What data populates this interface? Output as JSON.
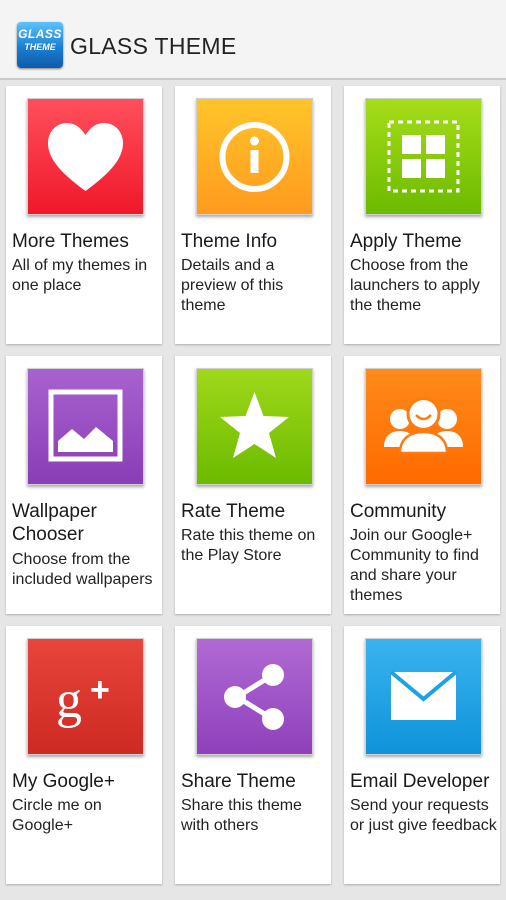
{
  "app": {
    "logo_text_1": "GLASS",
    "logo_text_2": "THEME",
    "title": "GLASS THEME"
  },
  "cards": [
    {
      "title": "More Themes",
      "desc": "All of my themes in one place",
      "icon": "heart-icon",
      "color_top": "#ff4f5c",
      "color_bottom": "#f0182a"
    },
    {
      "title": "Theme Info",
      "desc": "Details and a preview of this theme",
      "icon": "info-icon",
      "color_top": "#ffc52a",
      "color_bottom": "#ff9a1e"
    },
    {
      "title": "Apply Theme",
      "desc": "Choose from the launchers to apply the theme",
      "icon": "apply-grid-icon",
      "color_top": "#a6dd1a",
      "color_bottom": "#6cba00"
    },
    {
      "title": "Wallpaper Chooser",
      "desc": "Choose from the included wallpapers",
      "icon": "wallpaper-image-icon",
      "color_top": "#a862cf",
      "color_bottom": "#8a3db6"
    },
    {
      "title": "Rate Theme",
      "desc": "Rate this theme on the Play Store",
      "icon": "star-icon",
      "color_top": "#a0d81a",
      "color_bottom": "#6cba00"
    },
    {
      "title": "Community",
      "desc": "Join our Google+ Community to find and share your themes",
      "icon": "community-people-icon",
      "color_top": "#ff8a1a",
      "color_bottom": "#ff6a00"
    },
    {
      "title": "My Google+",
      "desc": "Circle me on Google+",
      "icon": "google-plus-icon",
      "color_top": "#e8463c",
      "color_bottom": "#cc2a22"
    },
    {
      "title": "Share Theme",
      "desc": "Share this theme with others",
      "icon": "share-icon",
      "color_top": "#b06ad4",
      "color_bottom": "#8f40bb"
    },
    {
      "title": "Email Developer",
      "desc": "Send your requests or just give feedback",
      "icon": "email-envelope-icon",
      "color_top": "#3ab3ef",
      "color_bottom": "#0f93da"
    }
  ]
}
